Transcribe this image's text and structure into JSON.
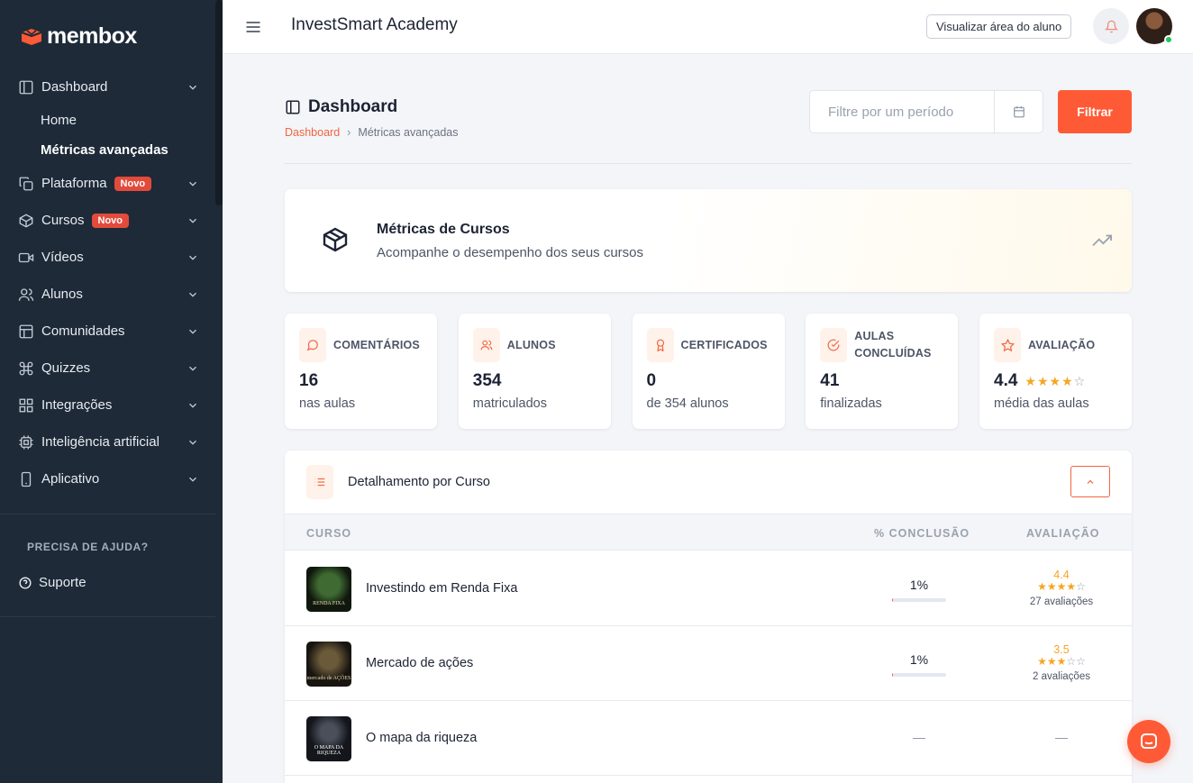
{
  "brand": {
    "name": "membox"
  },
  "sidebar": {
    "items": [
      {
        "label": "Dashboard",
        "icon": "layout-icon"
      },
      {
        "label": "Plataforma",
        "icon": "copy-icon",
        "badge": "Novo"
      },
      {
        "label": "Cursos",
        "icon": "box-icon",
        "badge": "Novo"
      },
      {
        "label": "Vídeos",
        "icon": "video-icon"
      },
      {
        "label": "Alunos",
        "icon": "users-icon"
      },
      {
        "label": "Comunidades",
        "icon": "layout-grid-icon"
      },
      {
        "label": "Quizzes",
        "icon": "command-icon"
      },
      {
        "label": "Integrações",
        "icon": "grid-icon"
      },
      {
        "label": "Inteligência artificial",
        "icon": "cpu-icon"
      },
      {
        "label": "Aplicativo",
        "icon": "smartphone-icon"
      }
    ],
    "dashboard_sub": {
      "home": "Home",
      "advanced": "Métricas avançadas"
    },
    "help_title": "PRECISA DE AJUDA?",
    "support_label": "Suporte"
  },
  "topbar": {
    "title": "InvestSmart Academy",
    "view_student_label": "Visualizar área do aluno"
  },
  "page": {
    "title": "Dashboard",
    "breadcrumb": {
      "root": "Dashboard",
      "separator": "›",
      "current": "Métricas avançadas"
    },
    "period_placeholder": "Filtre por um período",
    "filter_label": "Filtrar"
  },
  "banner": {
    "title": "Métricas de Cursos",
    "subtitle": "Acompanhe o desempenho dos seus cursos"
  },
  "stats": [
    {
      "label": "COMENTÁRIOS",
      "value": "16",
      "sub": "nas aulas",
      "icon": "message-circle-icon"
    },
    {
      "label": "ALUNOS",
      "value": "354",
      "sub": "matriculados",
      "icon": "users-icon"
    },
    {
      "label": "CERTIFICADOS",
      "value": "0",
      "sub": "de 354 alunos",
      "icon": "award-icon"
    },
    {
      "label": "AULAS CONCLUÍDAS",
      "value": "41",
      "sub": "finalizadas",
      "icon": "check-circle-icon"
    },
    {
      "label": "AVALIAÇÃO",
      "value": "4.4",
      "sub": "média das aulas",
      "icon": "star-icon",
      "stars": 4
    }
  ],
  "table": {
    "title": "Detalhamento por Curso",
    "headers": {
      "course": "CURSO",
      "completion": "% CONCLUSÃO",
      "rating": "AVALIAÇÃO"
    },
    "rows": [
      {
        "name": "Investindo em Renda Fixa",
        "completion": "1%",
        "completion_value": 0.01,
        "rating": "4.4",
        "stars": 4,
        "count": "27 avaliações",
        "thumb_caption": "RENDA FIXA"
      },
      {
        "name": "Mercado de ações",
        "completion": "1%",
        "completion_value": 0.01,
        "rating": "3.5",
        "stars": 3,
        "count": "2 avaliações",
        "thumb_caption": "mercado de AÇÕES"
      },
      {
        "name": "O mapa da riqueza",
        "completion": "—",
        "rating": "—",
        "thumb_caption": "O MAPA DA RIQUEZA"
      }
    ]
  },
  "colors": {
    "accent": "#ff5a36",
    "sidebar_bg": "#1e2a38",
    "star": "#f5a623",
    "badge": "#e24b3b"
  }
}
